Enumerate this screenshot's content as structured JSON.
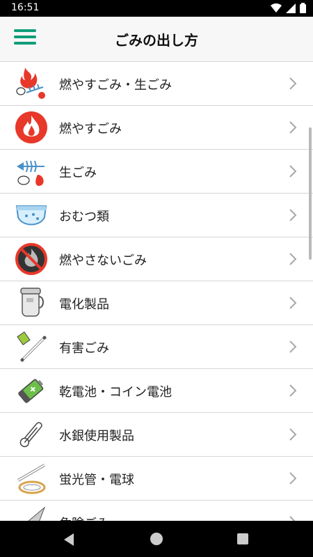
{
  "status": {
    "time": "16:51"
  },
  "appbar": {
    "title": "ごみの出し方"
  },
  "items": [
    {
      "label": "燃やすごみ・生ごみ"
    },
    {
      "label": "燃やすごみ"
    },
    {
      "label": "生ごみ"
    },
    {
      "label": "おむつ類"
    },
    {
      "label": "燃やさないごみ"
    },
    {
      "label": "電化製品"
    },
    {
      "label": "有害ごみ"
    },
    {
      "label": "乾電池・コイン電池"
    },
    {
      "label": "水銀使用製品"
    },
    {
      "label": "蛍光管・電球"
    },
    {
      "label": "危険ごみ"
    }
  ],
  "colors": {
    "accent": "#0f9d7a",
    "fire": "#e8382a",
    "battery": "#6cc04a"
  }
}
